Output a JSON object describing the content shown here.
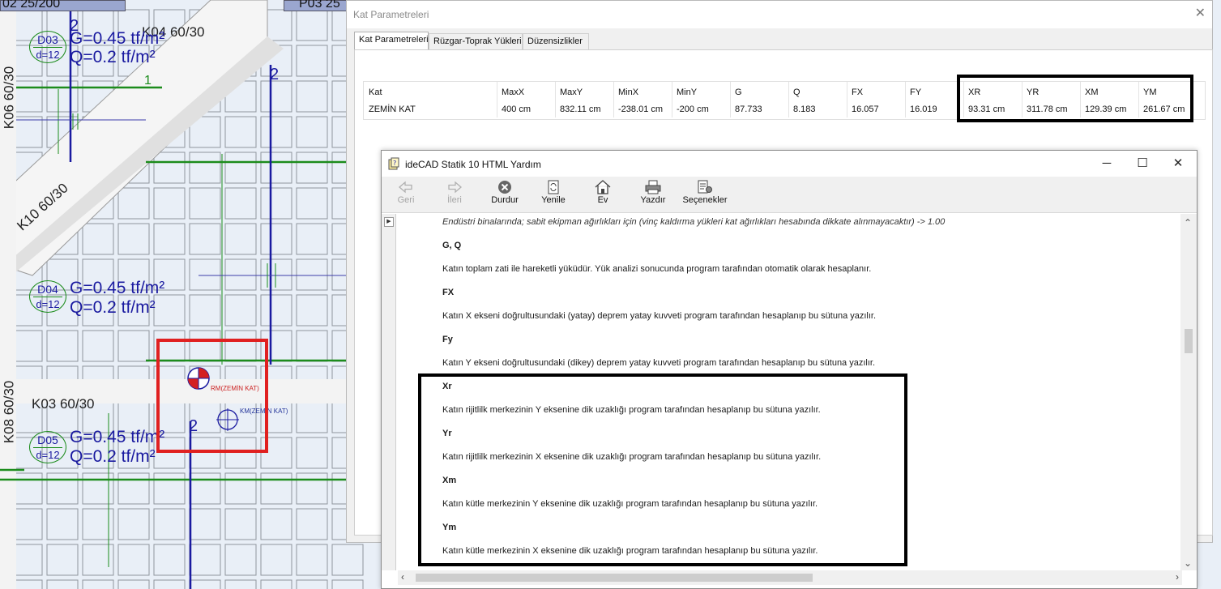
{
  "cad": {
    "top_labels": [
      "02 25/200",
      "P03 25"
    ],
    "beams": {
      "k04": "K04 60/30",
      "k06": "K06 60/30",
      "k10": "K10 60/30",
      "k03": "K03 60/30",
      "k08": "K08 60/30"
    },
    "slabs": [
      {
        "id": "D03",
        "d": "d=12",
        "g": "G=0.45 tf/m²",
        "q": "Q=0.2 tf/m²"
      },
      {
        "id": "D04",
        "d": "d=12",
        "g": "G=0.45 tf/m²",
        "q": "Q=0.2 tf/m²"
      },
      {
        "id": "D05",
        "d": "d=12",
        "g": "G=0.45 tf/m²",
        "q": "Q=0.2 tf/m²"
      }
    ],
    "axis_labels": {
      "a1": "2",
      "a2": "2",
      "a3": "2",
      "g1": "1"
    },
    "rm_label": "RM(ZEMİN KAT)",
    "km_label": "KM(ZEMİN KAT)"
  },
  "kat_dialog": {
    "title": "Kat Parametreleri",
    "tabs": [
      "Kat Parametreleri",
      "Rüzgar-Toprak Yükleri",
      "Düzensizlikler"
    ],
    "columns": [
      "Kat",
      "MaxX",
      "MaxY",
      "MinX",
      "MinY",
      "G",
      "Q",
      "FX",
      "FY",
      "XR",
      "YR",
      "XM",
      "YM"
    ],
    "row": [
      "ZEMİN KAT",
      "400 cm",
      "832.11 cm",
      "-238.01 cm",
      "-200 cm",
      "87.733",
      "8.183",
      "16.057",
      "16.019",
      "93.31 cm",
      "311.78 cm",
      "129.39 cm",
      "261.67 cm"
    ]
  },
  "help_window": {
    "title": "ideCAD Statik 10 HTML Yardım",
    "toolbar": [
      {
        "label": "Geri",
        "icon": "back-arrow-icon",
        "enabled": false
      },
      {
        "label": "İleri",
        "icon": "forward-arrow-icon",
        "enabled": false
      },
      {
        "label": "Durdur",
        "icon": "stop-icon",
        "enabled": true
      },
      {
        "label": "Yenile",
        "icon": "refresh-icon",
        "enabled": true
      },
      {
        "label": "Ev",
        "icon": "home-icon",
        "enabled": true
      },
      {
        "label": "Yazdır",
        "icon": "print-icon",
        "enabled": true
      },
      {
        "label": "Seçenekler",
        "icon": "options-icon",
        "enabled": true
      }
    ],
    "content": [
      {
        "type": "ital",
        "text": "Endüstri binalarında; sabit ekipman ağırlıkları için (vinç kaldırma yükleri kat ağırlıkları hesabında dikkate alınmayacaktır) -> 1.00"
      },
      {
        "type": "head",
        "text": "G, Q"
      },
      {
        "type": "text",
        "text": "Katın toplam zati ile hareketli yükü‌dür. Yük analizi sonucunda program tarafından otomatik olarak hesaplanır."
      },
      {
        "type": "head",
        "text": "FX"
      },
      {
        "type": "text",
        "text": "Katın X ekseni doğrultusundaki (yatay) deprem yatay kuvveti program tarafından hesaplanıp bu sütuna yazılır."
      },
      {
        "type": "head",
        "text": "Fy"
      },
      {
        "type": "text",
        "text": "Katın Y ekseni doğrultusundaki (dikey) deprem yatay kuvveti program tarafından hesaplanıp bu sütuna yazılır."
      },
      {
        "type": "head",
        "text": "Xr"
      },
      {
        "type": "text",
        "text": "Katın rijitlilk  merkezinin Y eksenine dik uzaklığı program tarafından hesaplanıp bu sütuna yazılır."
      },
      {
        "type": "head",
        "text": "Yr"
      },
      {
        "type": "text",
        "text": "Katın rijitlilk  merkezinin X eksenine dik uzaklığı program tarafından hesaplanıp bu sütuna yazılır."
      },
      {
        "type": "head",
        "text": "Xm"
      },
      {
        "type": "text",
        "text": "Katın kütle  merkezinin Y eksenine dik uzaklığı program tarafından hesaplanıp bu sütuna yazılır."
      },
      {
        "type": "head",
        "text": "Ym"
      },
      {
        "type": "text",
        "text": "Katın kütle  merkezinin X eksenine dik uzaklığı program tarafından hesaplanıp bu sütuna yazılır."
      }
    ]
  },
  "colors": {
    "highlight_red": "#e02020",
    "highlight_black": "#000000",
    "axis_blue": "#1a1aa0",
    "beam_green": "#1c8c1c"
  }
}
